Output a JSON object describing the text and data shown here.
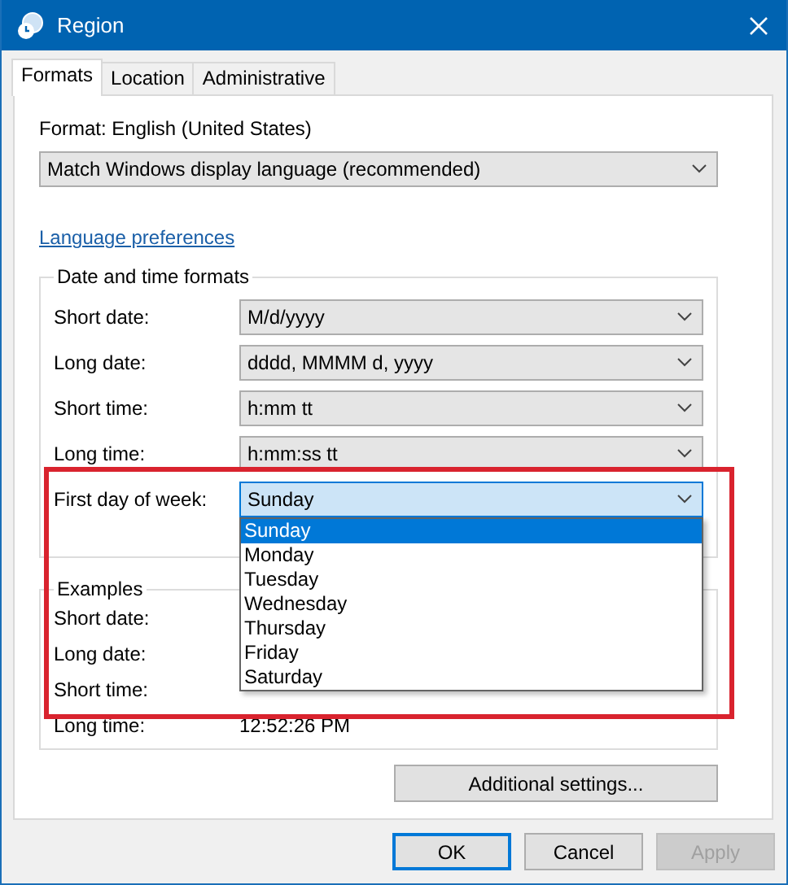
{
  "window": {
    "title": "Region"
  },
  "tabs": [
    {
      "label": "Formats",
      "selected": true
    },
    {
      "label": "Location",
      "selected": false
    },
    {
      "label": "Administrative",
      "selected": false
    }
  ],
  "format": {
    "label": "Format: English (United States)",
    "value": "Match Windows display language (recommended)"
  },
  "link": "Language preferences",
  "date_time_formats": {
    "title": "Date and time formats",
    "fields": [
      {
        "label": "Short date:",
        "value": "M/d/yyyy"
      },
      {
        "label": "Long date:",
        "value": "dddd, MMMM d, yyyy"
      },
      {
        "label": "Short time:",
        "value": "h:mm tt"
      },
      {
        "label": "Long time:",
        "value": "h:mm:ss tt"
      }
    ],
    "first_day": {
      "label": "First day of week:",
      "value": "Sunday",
      "expanded": true,
      "options": [
        {
          "label": "Sunday",
          "selected": true
        },
        {
          "label": "Monday",
          "selected": false
        },
        {
          "label": "Tuesday",
          "selected": false
        },
        {
          "label": "Wednesday",
          "selected": false
        },
        {
          "label": "Thursday",
          "selected": false
        },
        {
          "label": "Friday",
          "selected": false
        },
        {
          "label": "Saturday",
          "selected": false
        }
      ]
    }
  },
  "examples": {
    "title": "Examples",
    "rows": [
      {
        "label": "Short date:"
      },
      {
        "label": "Long date:"
      },
      {
        "label": "Short time:"
      },
      {
        "label": "Long time:",
        "value": "12:52:26 PM"
      }
    ]
  },
  "additional_button": "Additional settings...",
  "buttons": [
    {
      "label": "OK",
      "default": true,
      "disabled": false
    },
    {
      "label": "Cancel",
      "default": false,
      "disabled": false
    },
    {
      "label": "Apply",
      "default": false,
      "disabled": true
    }
  ]
}
